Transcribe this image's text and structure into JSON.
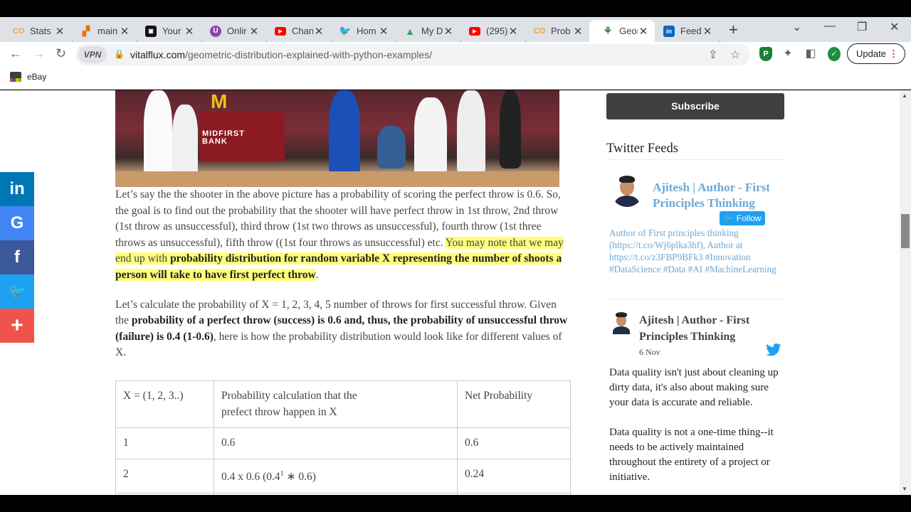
{
  "tabs": [
    {
      "label": "Stats",
      "favicon": "co-icon",
      "color": "#f2a33a",
      "active": false
    },
    {
      "label": "main",
      "favicon": "puzzle-icon",
      "color": "#e8710a",
      "active": false
    },
    {
      "label": "Your",
      "favicon": "site-icon",
      "color": "#111111",
      "active": false
    },
    {
      "label": "Onlir",
      "favicon": "u-icon",
      "color": "#8e44ad",
      "active": false
    },
    {
      "label": "Chan",
      "favicon": "youtube-icon",
      "color": "#ff0000",
      "active": false
    },
    {
      "label": "Hom",
      "favicon": "twitter-icon",
      "color": "#1da1f2",
      "active": false
    },
    {
      "label": "My D",
      "favicon": "drive-icon",
      "color": "#34a853",
      "active": false
    },
    {
      "label": "(295)",
      "favicon": "youtube-icon",
      "color": "#ff0000",
      "active": false
    },
    {
      "label": "Prob",
      "favicon": "co-icon",
      "color": "#f2a33a",
      "active": false
    },
    {
      "label": "Geon",
      "favicon": "tree-icon",
      "color": "#2e7d32",
      "active": true
    },
    {
      "label": "Feed",
      "favicon": "linkedin-icon",
      "color": "#0a66c2",
      "active": false
    }
  ],
  "tab_close_glyph": "✕",
  "newtab_glyph": "+",
  "window": {
    "minimize": "—",
    "restore": "❐",
    "close": "✕",
    "tabsearch": "⌄"
  },
  "nav": {
    "back": "←",
    "forward": "→",
    "reload": "↻"
  },
  "omnibox": {
    "vpn_label": "VPN",
    "url_domain": "vitalflux.com",
    "url_path": "/geometric-distribution-explained-with-python-examples/"
  },
  "update_label": "Update",
  "bookmark": {
    "label": "eBay"
  },
  "article": {
    "p1_plain": "Let’s say the the shooter in the above picture has a probability of scoring the perfect throw is 0.6. So, the goal is to find out the probability that the shooter will have perfect throw in 1st throw, 2nd throw (1st throw as unsuccessful), third throw (1st two throws as unsuccessful), fourth throw (1st three throws as unsuccessful), fifth throw ((1st four throws as unsuccessful) etc. ",
    "p1_hl_plain": "You may note that we may end up with ",
    "p1_hl_bold": "probability distribution for random variable X representing the number of shoots a person will take to have first perfect throw",
    "p1_end": ".",
    "p2_a": "Let’s calculate the probability of X = 1, 2, 3, 4, 5 number of throws for first successful throw. Given the ",
    "p2_bold": "probability of a perfect throw (success) is 0.6 and, thus, the probability of unsuccessful throw (failure) is 0.4 (1-0.6)",
    "p2_b": ", here is how the probability distribution would look like for different values of X."
  },
  "table": {
    "headers": [
      "X = (1, 2, 3..)",
      "Probability calculation that the prefect throw happen in X",
      "Net Probability"
    ],
    "rows": [
      {
        "x": "1",
        "calc": "0.6",
        "net": "0.6"
      },
      {
        "x": "2",
        "calc_a": "0.4 x 0.6 (0.4",
        "calc_sup": "1",
        "calc_b": " ∗ 0.6)",
        "net": "0.24"
      }
    ]
  },
  "sidebar": {
    "subscribe_label": "Subscribe",
    "twitter_heading": "Twitter Feeds",
    "profile_name": "Ajitesh | Author - First Principles Thinking",
    "follow_label": "Follow",
    "bio": "Author of First principles thinking (https://t.co/Wj6plka3hf), Author at https://t.co/z3FBP9BFk3 #Innovation #DataScience #Data #AI #MachineLearning",
    "tweet_author": "Ajitesh | Author - First Principles Thinking",
    "tweet_date": "6 Nov",
    "tweet_p1": "Data quality isn't just about cleaning up dirty data, it's also about making sure your data is accurate and reliable.",
    "tweet_p2": "Data quality is not a one-time thing--it needs to be actively maintained throughout the entirety of a project or initiative."
  },
  "share": [
    {
      "name": "linkedin",
      "glyph": "in",
      "color": "#0077b5"
    },
    {
      "name": "google",
      "glyph": "G",
      "color": "#4285f4"
    },
    {
      "name": "facebook",
      "glyph": "f",
      "color": "#3b5998"
    },
    {
      "name": "twitter",
      "glyph": "🐦",
      "color": "#1da1f2"
    },
    {
      "name": "more",
      "glyph": "+",
      "color": "#f0524c"
    }
  ],
  "hero": {
    "sign_line1": "MIDFIRST",
    "sign_line2": "BANK",
    "logo_glyph": "M"
  },
  "colors": {
    "highlight": "#ffff7a",
    "link": "#6ea8d4",
    "subscribe_bg": "#3f3f3f"
  }
}
